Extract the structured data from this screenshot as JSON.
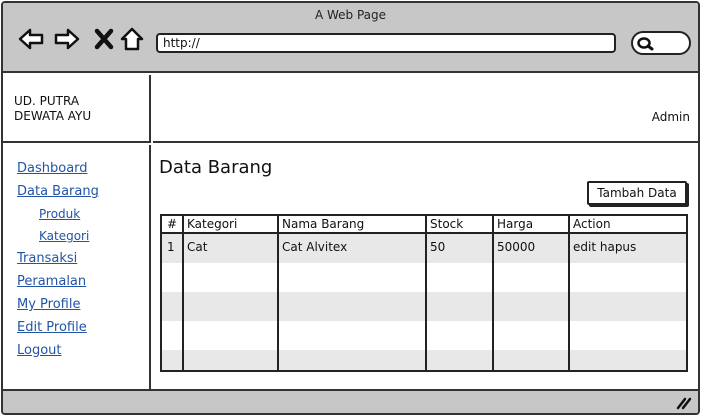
{
  "browser": {
    "page_title": "A Web Page",
    "url": "http://",
    "nav_icons": [
      "back-icon",
      "forward-icon",
      "close-icon",
      "home-icon"
    ],
    "search_icon": "search-icon"
  },
  "header": {
    "brand": "UD. PUTRA DEWATA AYU",
    "user": "Admin"
  },
  "sidebar": {
    "items": [
      {
        "label": "Dashboard"
      },
      {
        "label": "Data Barang"
      },
      {
        "label": "Produk"
      },
      {
        "label": "Kategori"
      },
      {
        "label": "Transaksi"
      },
      {
        "label": "Peramalan"
      },
      {
        "label": "My Profile"
      },
      {
        "label": "Edit Profile"
      },
      {
        "label": "Logout"
      }
    ]
  },
  "main": {
    "heading": "Data Barang",
    "add_button": "Tambah Data",
    "table": {
      "columns": [
        "#",
        "Kategori",
        "Nama Barang",
        "Stock",
        "Harga",
        "Action"
      ],
      "rows": [
        [
          "1",
          "Cat",
          "Cat Alvitex",
          "50",
          "50000",
          "edit hapus"
        ]
      ]
    }
  },
  "colors": {
    "chrome": "#c7c7c7",
    "link": "#2255a6",
    "stripe": "#e8e8e8"
  }
}
